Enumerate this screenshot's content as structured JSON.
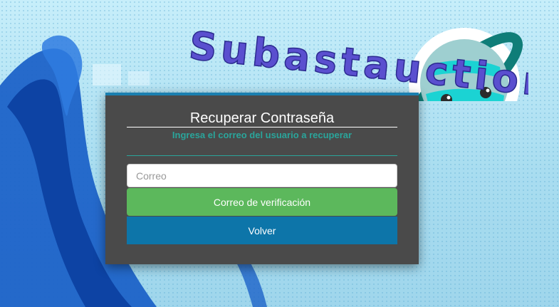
{
  "brand": {
    "name": "Subastauction"
  },
  "form": {
    "title": "Recuperar Contraseña",
    "subtitle": "Ingresa el correo del usuario a recuperar",
    "email": {
      "placeholder": "Correo",
      "value": ""
    },
    "verify_button_label": "Correo de verificación",
    "back_button_label": "Volver"
  },
  "colors": {
    "background": "#aee3f3",
    "card": "#4a4a4a",
    "card_top_border": "#1a7fb0",
    "subtitle_accent": "#2aa59b",
    "primary_green": "#5cb85c",
    "primary_blue": "#0d75a9",
    "brand_text": "#5a4fcf",
    "planet_ring": "#0f7d78"
  },
  "icons": {
    "mascot": "planet-mascot-icon"
  }
}
